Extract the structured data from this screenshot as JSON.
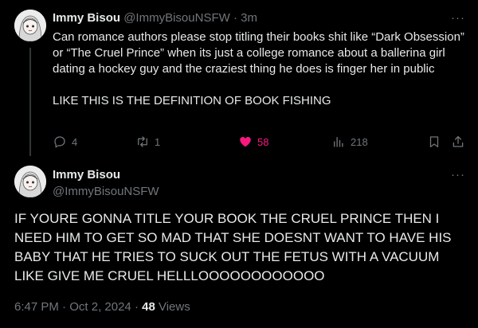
{
  "post1": {
    "name": "Immy Bisou",
    "handle": "@ImmyBisouNSFW",
    "time": "3m",
    "more": "···",
    "paragraphs": [
      "Can romance authors please stop titling their books shit like “Dark Obsession” or “The Cruel Prince” when its just a college romance about a ballerina girl dating a hockey guy and the craziest thing he does is finger her in public",
      "LIKE THIS IS THE DEFINITION OF BOOK FISHING"
    ],
    "actions": {
      "replies": "4",
      "reposts": "1",
      "likes": "58",
      "views": "218"
    },
    "icons": [
      "reply-icon",
      "repost-icon",
      "heart-icon",
      "views-icon",
      "bookmark-icon",
      "share-icon"
    ],
    "like_color": "#f91880"
  },
  "post2": {
    "name": "Immy Bisou",
    "handle": "@ImmyBisouNSFW",
    "more": "···",
    "text": "IF YOURE GONNA TITLE YOUR BOOK THE CRUEL PRINCE THEN I NEED HIM TO GET SO MAD THAT SHE DOESNT WANT TO HAVE HIS BABY THAT HE TRIES TO SUCK OUT THE FETUS WITH A VACUUM LIKE GIVE ME CRUEL HELLLOOOOOOOOOOOO",
    "time": "6:47 PM",
    "date": "Oct 2, 2024",
    "views_count": "48",
    "views_label": "Views"
  },
  "colors": {
    "background": "#000000",
    "text": "#e7e9ea",
    "muted": "#71767b",
    "thread_line": "#333639"
  }
}
